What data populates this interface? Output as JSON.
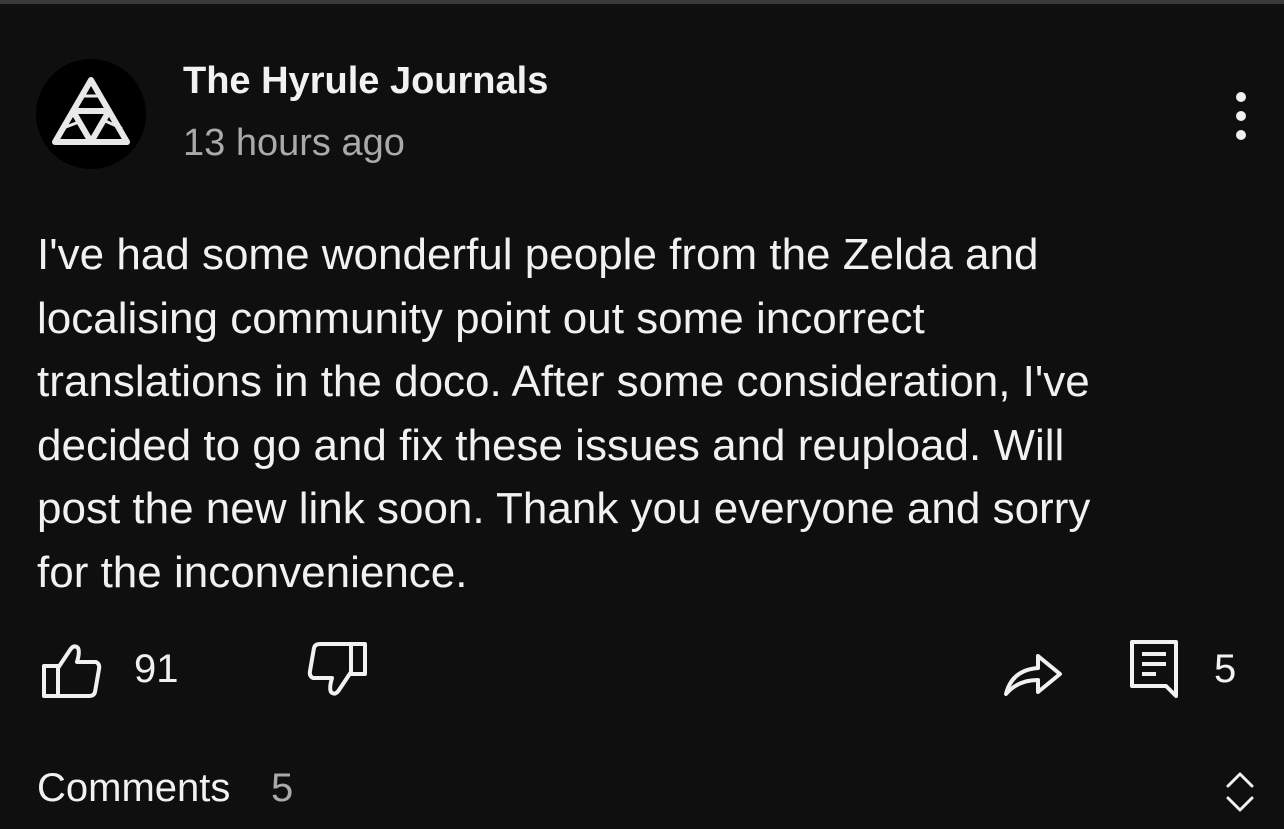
{
  "post": {
    "author": "The Hyrule Journals",
    "timestamp": "13 hours ago",
    "avatar_icon": "triforce-icon",
    "more_icon": "more-vertical-icon",
    "text_lines": [
      "I've had some wonderful people from the Zelda and",
      "localising community point out some incorrect",
      "translations in the doco. After some consideration, I've",
      "decided to go and fix these issues and reupload. Will",
      "post the new link soon. Thank you everyone and sorry",
      "for the inconvenience."
    ]
  },
  "actions": {
    "like_icon": "thumbs-up-icon",
    "like_count": "91",
    "dislike_icon": "thumbs-down-icon",
    "share_icon": "share-icon",
    "comment_icon": "comment-icon",
    "comment_count": "5"
  },
  "comments": {
    "label": "Comments",
    "count": "5",
    "expand_icon": "expand-collapse-icon"
  },
  "colors": {
    "background": "#0f0f0f",
    "text_primary": "#f1f1f1",
    "text_secondary": "#aaaaaa"
  }
}
